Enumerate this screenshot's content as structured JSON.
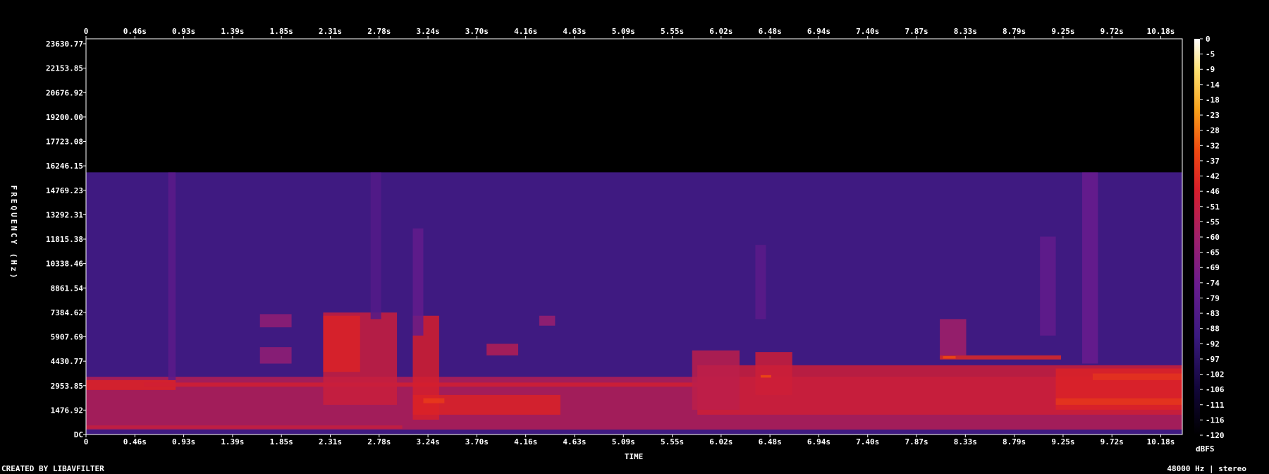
{
  "chart_data": {
    "type": "heatmap",
    "title": "",
    "xlabel": "TIME",
    "ylabel": "FREQUENCY (Hz)",
    "x_unit": "s",
    "xlim": [
      0,
      10.4
    ],
    "ylim": [
      0,
      24000
    ],
    "x_ticks": [
      "0",
      "0.46s",
      "0.93s",
      "1.39s",
      "1.85s",
      "2.31s",
      "2.78s",
      "3.24s",
      "3.70s",
      "4.16s",
      "4.63s",
      "5.09s",
      "5.55s",
      "6.02s",
      "6.48s",
      "6.94s",
      "7.40s",
      "7.87s",
      "8.33s",
      "8.79s",
      "9.25s",
      "9.72s",
      "10.18s"
    ],
    "y_ticks": [
      "DC",
      "1476.92",
      "2953.85",
      "4430.77",
      "5907.69",
      "7384.62",
      "8861.54",
      "10338.46",
      "11815.38",
      "13292.31",
      "14769.23",
      "16246.15",
      "17723.08",
      "19200.00",
      "20676.92",
      "22153.85",
      "23630.77"
    ],
    "colorbar_label": "dBFS",
    "colorbar_ticks": [
      "0",
      "-5",
      "-9",
      "-14",
      "-18",
      "-23",
      "-28",
      "-32",
      "-37",
      "-42",
      "-46",
      "-51",
      "-55",
      "-60",
      "-65",
      "-69",
      "-74",
      "-79",
      "-83",
      "-88",
      "-92",
      "-97",
      "-102",
      "-106",
      "-111",
      "-116",
      "-120"
    ],
    "noise_floor_dbfs": -92,
    "bandwidth_cutoff_hz": 15900,
    "colormap": [
      "#000000",
      "#12063a",
      "#3a1a80",
      "#6a1c8e",
      "#a0206a",
      "#d81e2a",
      "#f04a10",
      "#f8a01a",
      "#fde070",
      "#ffffff"
    ],
    "energy_regions": [
      {
        "t0": 0.0,
        "t1": 10.4,
        "f0": 300,
        "f1": 3500,
        "db": -62
      },
      {
        "t0": 0.0,
        "t1": 0.85,
        "f0": 2700,
        "f1": 3300,
        "db": -52
      },
      {
        "t0": 0.55,
        "t1": 5.8,
        "f0": 2900,
        "f1": 3150,
        "db": -55
      },
      {
        "t0": 0.0,
        "t1": 3.0,
        "f0": 350,
        "f1": 550,
        "db": -58
      },
      {
        "t0": 2.25,
        "t1": 2.95,
        "f0": 1800,
        "f1": 7400,
        "db": -57
      },
      {
        "t0": 2.25,
        "t1": 2.6,
        "f0": 3800,
        "f1": 7200,
        "db": -52
      },
      {
        "t0": 3.1,
        "t1": 3.35,
        "f0": 900,
        "f1": 7200,
        "db": -54
      },
      {
        "t0": 3.1,
        "t1": 4.5,
        "f0": 1200,
        "f1": 2400,
        "db": -52
      },
      {
        "t0": 3.2,
        "t1": 3.4,
        "f0": 1900,
        "f1": 2200,
        "db": -45
      },
      {
        "t0": 1.65,
        "t1": 1.95,
        "f0": 6500,
        "f1": 7300,
        "db": -70
      },
      {
        "t0": 1.65,
        "t1": 1.95,
        "f0": 4300,
        "f1": 5300,
        "db": -70
      },
      {
        "t0": 3.8,
        "t1": 4.1,
        "f0": 4800,
        "f1": 5500,
        "db": -62
      },
      {
        "t0": 4.3,
        "t1": 4.45,
        "f0": 6600,
        "f1": 7200,
        "db": -68
      },
      {
        "t0": 5.8,
        "t1": 10.4,
        "f0": 1200,
        "f1": 4200,
        "db": -56
      },
      {
        "t0": 5.75,
        "t1": 6.2,
        "f0": 1500,
        "f1": 5100,
        "db": -60
      },
      {
        "t0": 6.35,
        "t1": 6.7,
        "f0": 2400,
        "f1": 5000,
        "db": -56
      },
      {
        "t0": 6.4,
        "t1": 6.5,
        "f0": 3450,
        "f1": 3600,
        "db": -40
      },
      {
        "t0": 8.1,
        "t1": 8.35,
        "f0": 4800,
        "f1": 7000,
        "db": -66
      },
      {
        "t0": 8.1,
        "t1": 9.25,
        "f0": 4550,
        "f1": 4800,
        "db": -50
      },
      {
        "t0": 8.13,
        "t1": 8.25,
        "f0": 4600,
        "f1": 4750,
        "db": -40
      },
      {
        "t0": 9.2,
        "t1": 10.4,
        "f0": 1500,
        "f1": 4000,
        "db": -52
      },
      {
        "t0": 9.2,
        "t1": 10.4,
        "f0": 1800,
        "f1": 2200,
        "db": -46
      },
      {
        "t0": 9.55,
        "t1": 10.4,
        "f0": 3300,
        "f1": 3700,
        "db": -47
      },
      {
        "t0": 9.45,
        "t1": 9.6,
        "f0": 4300,
        "f1": 15900,
        "db": -80
      },
      {
        "t0": 0.78,
        "t1": 0.85,
        "f0": 3300,
        "f1": 15900,
        "db": -84
      },
      {
        "t0": 3.1,
        "t1": 3.2,
        "f0": 6000,
        "f1": 12500,
        "db": -82
      },
      {
        "t0": 2.7,
        "t1": 2.8,
        "f0": 7000,
        "f1": 15900,
        "db": -86
      },
      {
        "t0": 6.35,
        "t1": 6.45,
        "f0": 7000,
        "f1": 11500,
        "db": -84
      },
      {
        "t0": 9.05,
        "t1": 9.2,
        "f0": 6000,
        "f1": 12000,
        "db": -82
      }
    ]
  },
  "footer": {
    "created_by": "CREATED BY LIBAVFILTER",
    "sample_info": "48000 Hz | stereo"
  }
}
